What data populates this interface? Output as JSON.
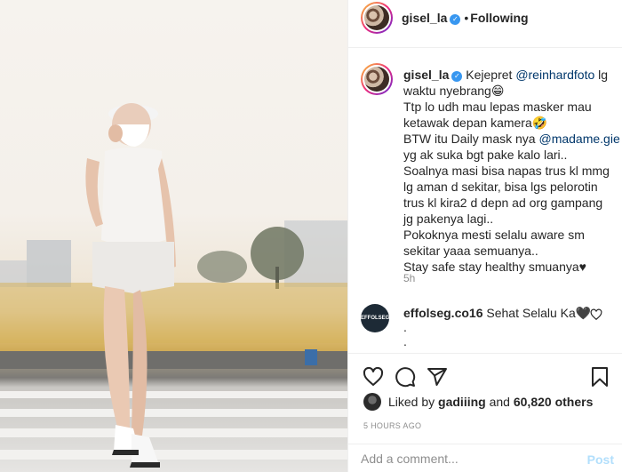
{
  "post": {
    "username": "gisel_la",
    "verified_mark": "✓",
    "separator": "•",
    "follow_status": "Following"
  },
  "caption": {
    "username": "gisel_la",
    "line1_prefix": " Kejepret ",
    "line1_mention": "@reinhardfoto",
    "line1_suffix": " lg",
    "line2": "waktu nyebrang😁",
    "line3": "Ttp lo udh mau lepas masker mau",
    "line4": "ketawak depan kamera🤣",
    "line5_prefix": "BTW itu Daily mask nya ",
    "line5_mention": "@madame.gie",
    "line6": "yg ak suka bgt pake kalo lari..",
    "line7": "Soalnya masi bisa napas trus kl mmg",
    "line8": "lg aman d sekitar, bisa lgs pelorotin",
    "line9": "trus kl kira2 d depn ad org gampang",
    "line10": "jg pakenya lagi..",
    "line11": "Pokoknya mesti selalu aware sm",
    "line12": "sekitar yaaa semuanya..",
    "line13": "Stay safe stay healthy smuanya♥",
    "time": "5h"
  },
  "comment": {
    "username": "effolseg.co16",
    "text": " Sehat Selalu Ka🖤",
    "avatar_text": "EFFOLSEG.CO",
    "extra_line1": ".",
    "extra_line2": "."
  },
  "actions": {
    "icons": [
      "heart-icon",
      "comment-icon",
      "share-icon",
      "bookmark-icon"
    ]
  },
  "likes": {
    "prefix": "Liked by ",
    "user": "gadiiing",
    "middle": " and ",
    "count": "60,820 others"
  },
  "timestamp": "5 HOURS AGO",
  "add_comment": {
    "placeholder": "Add a comment...",
    "post_label": "Post"
  },
  "colors": {
    "accent": "#3897f0",
    "mention": "#00376b",
    "muted": "#8e8e8e",
    "post_disabled": "#b2dffc"
  }
}
